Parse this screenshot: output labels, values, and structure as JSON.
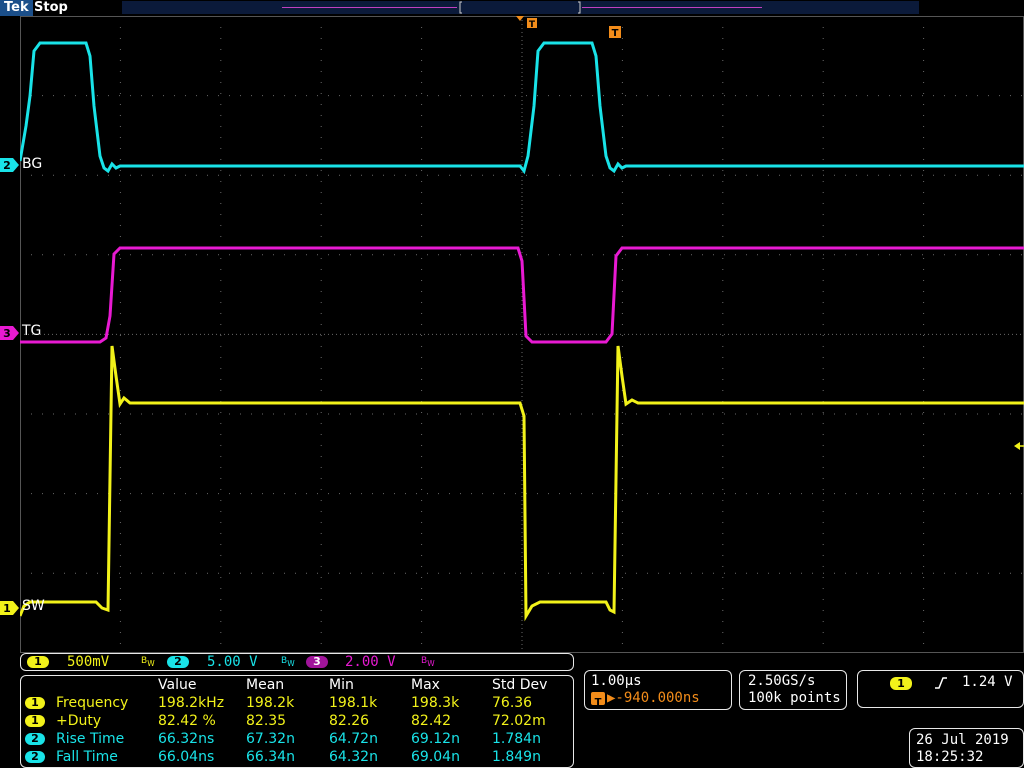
{
  "header": {
    "brand": "Tek",
    "acquisition_state": "Stop",
    "trigger_marker": "T"
  },
  "channels": [
    {
      "id": "2",
      "label": "BG",
      "color": "#19e3e8"
    },
    {
      "id": "3",
      "label": "TG",
      "color": "#e81ad2"
    },
    {
      "id": "1",
      "label": "SW",
      "color": "#f2f21a"
    }
  ],
  "vertical": [
    {
      "id": "1",
      "scale": "500mV",
      "color": "#f2f21a"
    },
    {
      "id": "2",
      "scale": "5.00 V",
      "color": "#19e3e8"
    },
    {
      "id": "3",
      "scale": "2.00 V",
      "color": "#e81ad2"
    }
  ],
  "measurements": {
    "headers": [
      "Value",
      "Mean",
      "Min",
      "Max",
      "Std Dev"
    ],
    "rows": [
      {
        "ch": "1",
        "name": "Frequency",
        "value": "198.2kHz",
        "mean": "198.2k",
        "min": "198.1k",
        "max": "198.3k",
        "std": "76.36",
        "color": "#f2f21a"
      },
      {
        "ch": "1",
        "name": "+Duty",
        "value": "82.42 %",
        "mean": "82.35",
        "min": "82.26",
        "max": "82.42",
        "std": "72.02m",
        "color": "#f2f21a"
      },
      {
        "ch": "2",
        "name": "Rise Time",
        "value": "66.32ns",
        "mean": "67.32n",
        "min": "64.72n",
        "max": "69.12n",
        "std": "1.784n",
        "color": "#19e3e8"
      },
      {
        "ch": "2",
        "name": "Fall Time",
        "value": "66.04ns",
        "mean": "66.34n",
        "min": "64.32n",
        "max": "69.04n",
        "std": "1.849n",
        "color": "#19e3e8"
      }
    ]
  },
  "horizontal": {
    "scale": "1.00µs",
    "trigger_position": "▶-940.000ns",
    "sample_rate": "2.50GS/s",
    "record_length": "100k points"
  },
  "trigger": {
    "source": "1",
    "slope_icon": "rising-edge-icon",
    "level": "1.24 V"
  },
  "datetime": {
    "date": "26 Jul  2019",
    "time": "18:25:32"
  }
}
